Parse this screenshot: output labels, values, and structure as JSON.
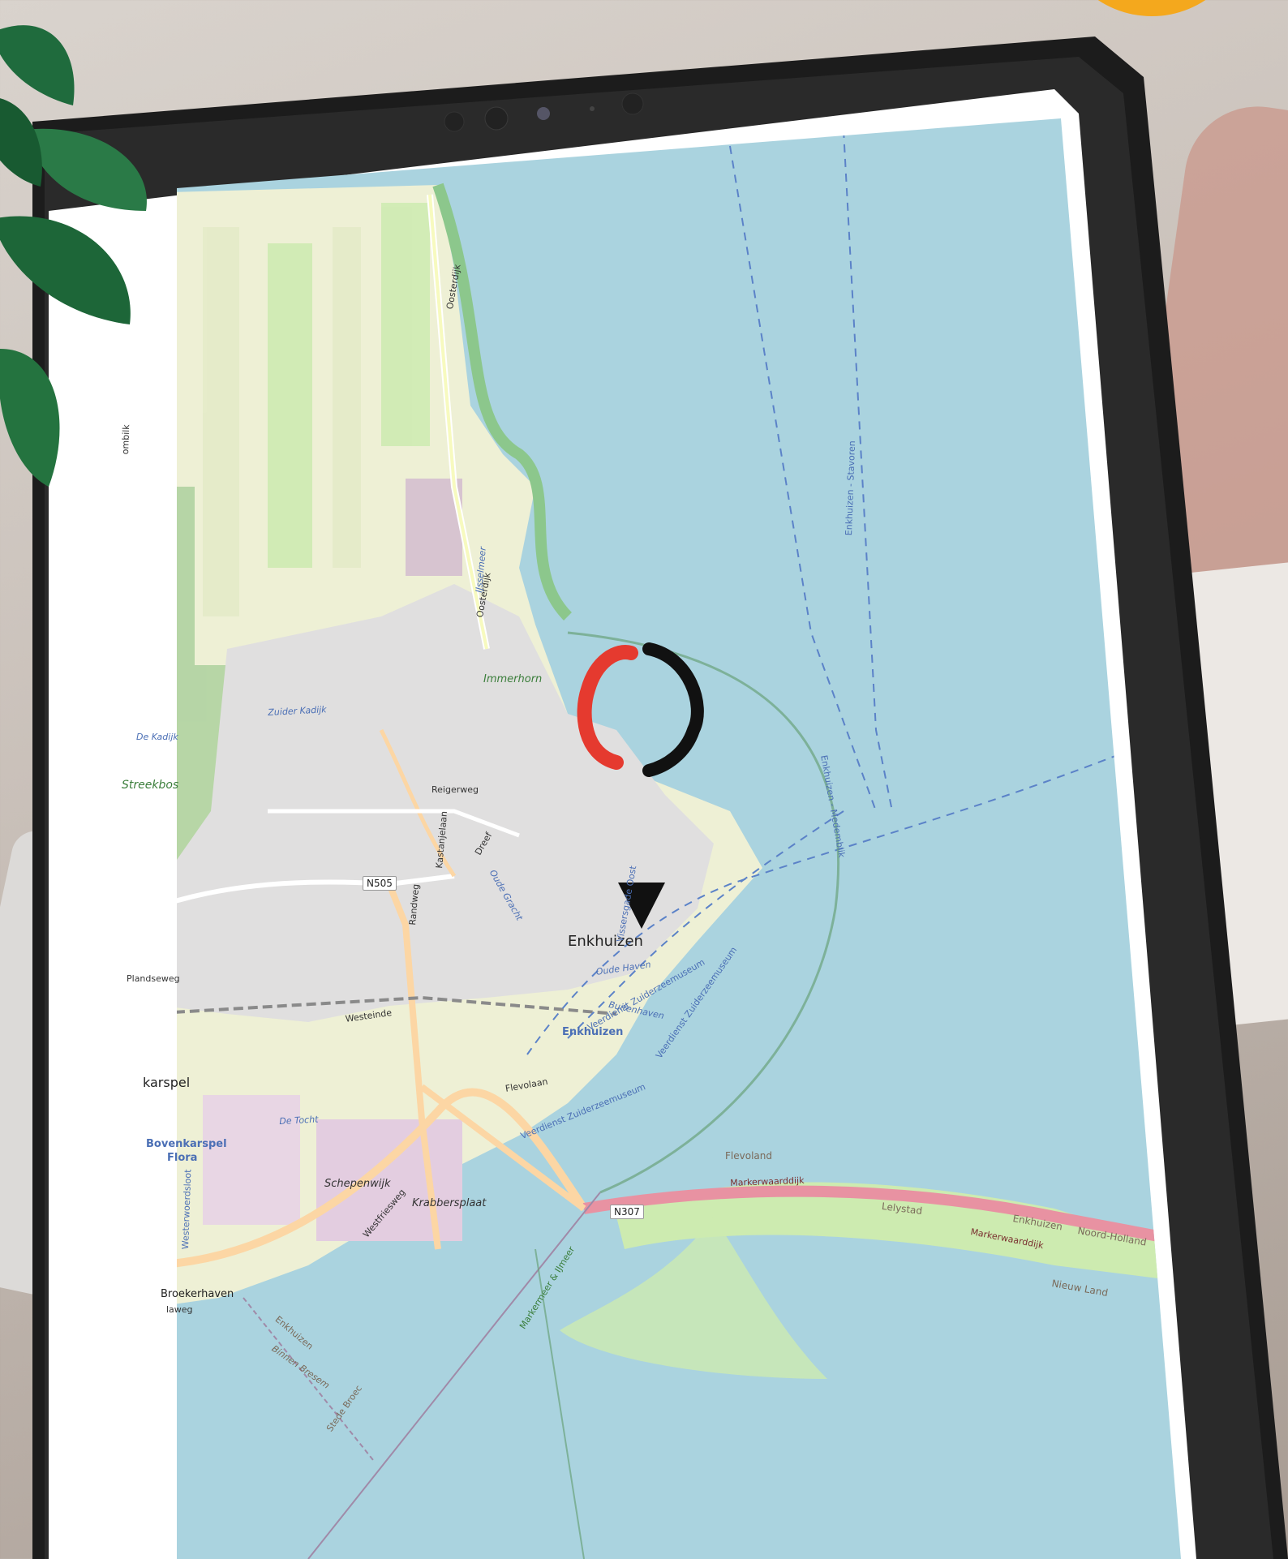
{
  "map": {
    "place_labels": {
      "enkhuizen_main": "Enkhuizen",
      "enkhuizen_station": "Enkhuizen",
      "bovenkarspel_flora": "Bovenkarspel\nFlora",
      "bovenkarspel": "Bovenkarspel",
      "flora": "Flora",
      "broekerhaven": "Broekerhaven",
      "streekbos": "Streekbos",
      "immerhorn": "Immerhorn",
      "schepenwijk": "Schepenwijk",
      "krabbersplaat": "Krabbersplaat",
      "flevoland": "Flevoland",
      "lelystad": "Lelystad",
      "nieuw_land": "Nieuw Land",
      "noord_holland": "Noord-Holland",
      "enkhuizen_right": "Enkhuizen",
      "binnen_bresem": "Binnen Bresem",
      "enkhuizen_lower": "Enkhuizen",
      "stede_broec": "Stede Broec",
      "karspel": "karspel"
    },
    "road_labels": {
      "oosterdijk_top": "Oosterdijk",
      "oosterdijk_mid": "Oosterdijk",
      "reigerweg": "Reigerweg",
      "kastanjelaan": "Kastanjelaan",
      "dreef": "Dreef",
      "randweg": "Randweg",
      "n505": "N505",
      "westeinde": "Westeinde",
      "flevolaan": "Flevolaan",
      "westfriesweg": "Westfriesweg",
      "n307": "N307",
      "markerwaarddijk_1": "Markerwaarddijk",
      "markerwaarddijk_2": "Markerwaarddijk",
      "plandseweg": "Plandseweg",
      "laweg": "laweg",
      "westerwoerdsloot": "Westerwoerdsloot",
      "ombilk": "ombilk"
    },
    "water_labels": {
      "ijsselmeer": "IJsselmeer",
      "zuider_kadijk": "Zuider Kadijk",
      "de_kadijk": "De Kadijk",
      "oude_gracht": "Oude Gracht",
      "oude_haven": "Oude Haven",
      "buitenhaven": "Buitenhaven",
      "de_tocht": "De Tocht",
      "ferry_stavoren": "Enkhuizen - Stavoren",
      "ferry_medemblik": "Enkhuizen - Medemblik",
      "ferry_zuiderzee_1": "Veerdienst Zuiderzeemuseum",
      "ferry_zuiderzee_2": "Veerdienst Zuiderzeemuseum",
      "ferry_zuiderzee_3": "Veerdienst Zuiderzeemuseum",
      "markermeer_ijmeer": "Markermeer & IJmeer",
      "vissergade": "Vissersgade Oost"
    },
    "marker": {
      "icon": "location-pin-icon",
      "ring_colors": [
        "#e53a2f",
        "#111111"
      ]
    },
    "colors": {
      "water": "#aad3df",
      "farmland": "#eef0d5",
      "grass": "#cdebb0",
      "urban": "#e0dfdf",
      "motorway": "#e892a2",
      "primary_road": "#fcd6a4",
      "accent": "#f4a81d"
    }
  }
}
